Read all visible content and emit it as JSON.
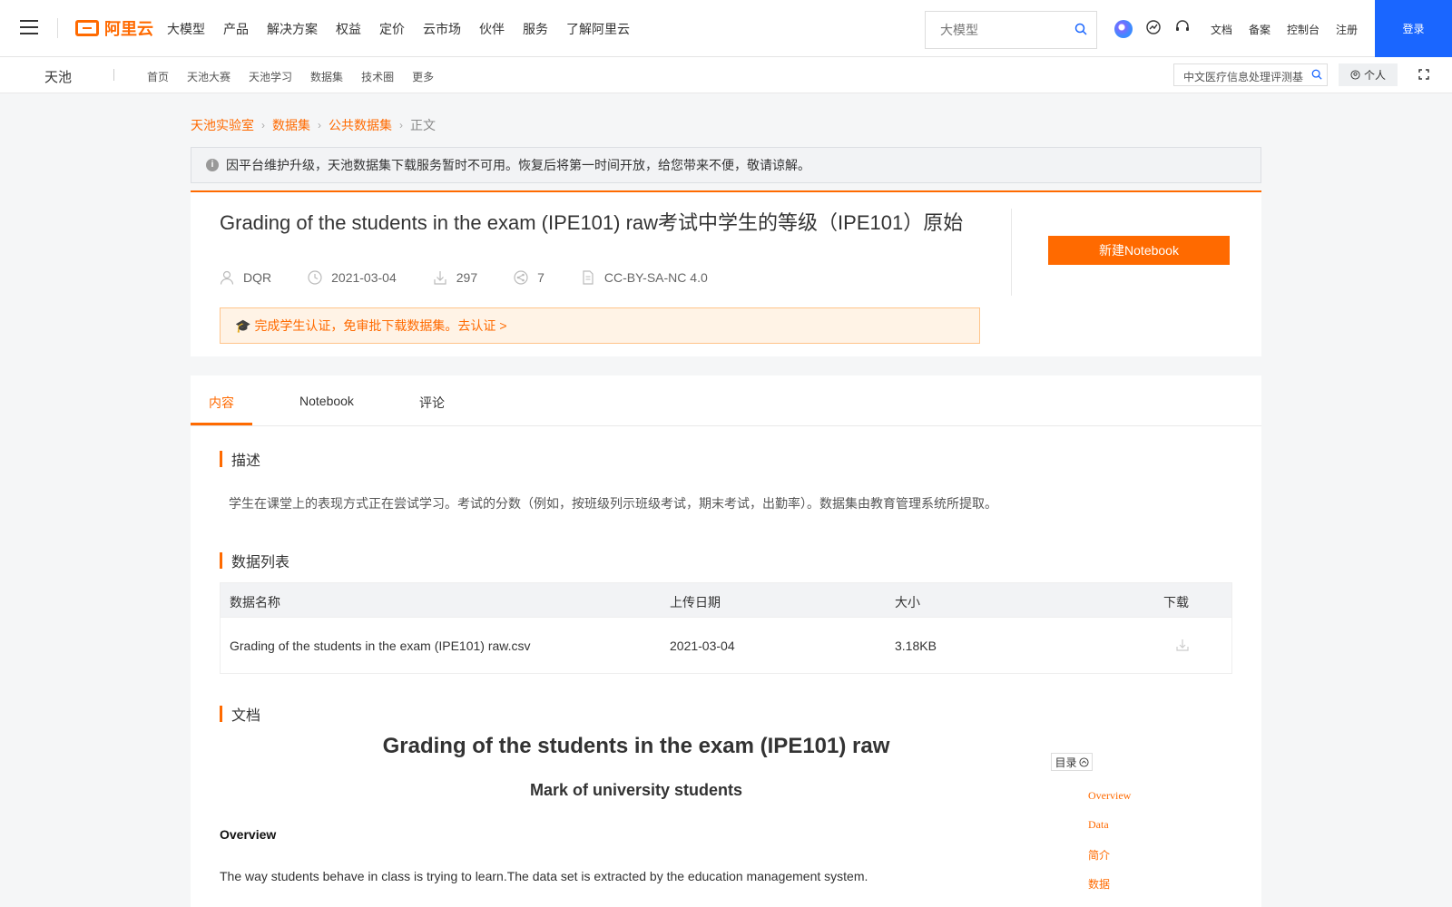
{
  "topnav": {
    "menu": [
      "大模型",
      "产品",
      "解决方案",
      "权益",
      "定价",
      "云市场",
      "伙伴",
      "服务",
      "了解阿里云"
    ],
    "search_placeholder": "大模型",
    "links": [
      "文档",
      "备案",
      "控制台",
      "注册"
    ],
    "login_label": "登录",
    "logo_text": "阿里云"
  },
  "subnav": {
    "brand": "天池",
    "menu": [
      "首页",
      "天池大赛",
      "天池学习",
      "数据集",
      "技术圈",
      "更多"
    ],
    "search_value": "中文医疗信息处理评测基",
    "personal_label": "个人"
  },
  "breadcrumb": [
    "天池实验室",
    "数据集",
    "公共数据集",
    "正文"
  ],
  "notice": "因平台维护升级，天池数据集下载服务暂时不可用。恢复后将第一时间开放，给您带来不便，敬请谅解。",
  "dataset": {
    "title": "Grading of the students in the exam (IPE101) raw考试中学生的等级（IPE101）原始",
    "author": "DQR",
    "date": "2021-03-04",
    "downloads": "297",
    "shares": "7",
    "license": "CC-BY-SA-NC 4.0",
    "cert_text": "完成学生认证，免审批下载数据集。去认证 >",
    "new_notebook": "新建Notebook"
  },
  "tabs": [
    "内容",
    "Notebook",
    "评论"
  ],
  "sections": {
    "desc_title": "描述",
    "desc_text": "学生在课堂上的表现方式正在尝试学习。考试的分数（例如，按班级列示班级考试，期末考试，出勤率）。数据集由教育管理系统所提取。",
    "list_title": "数据列表",
    "doc_title": "文档"
  },
  "table": {
    "headers": [
      "数据名称",
      "上传日期",
      "大小",
      "下载"
    ],
    "rows": [
      {
        "name": "Grading of the students in the exam (IPE101) raw.csv",
        "date": "2021-03-04",
        "size": "3.18KB"
      }
    ]
  },
  "doc": {
    "h1": "Grading of the students in the exam (IPE101) raw",
    "h2": "Mark of university students",
    "overview": "Overview",
    "para": "The way students behave in class is trying to learn.The data set is extracted by the education management system."
  },
  "toc": {
    "label": "目录",
    "items": [
      "Overview",
      "Data",
      "简介",
      "数据"
    ]
  },
  "colors": {
    "accent": "#ff6a00",
    "login": "#1a66ff"
  }
}
